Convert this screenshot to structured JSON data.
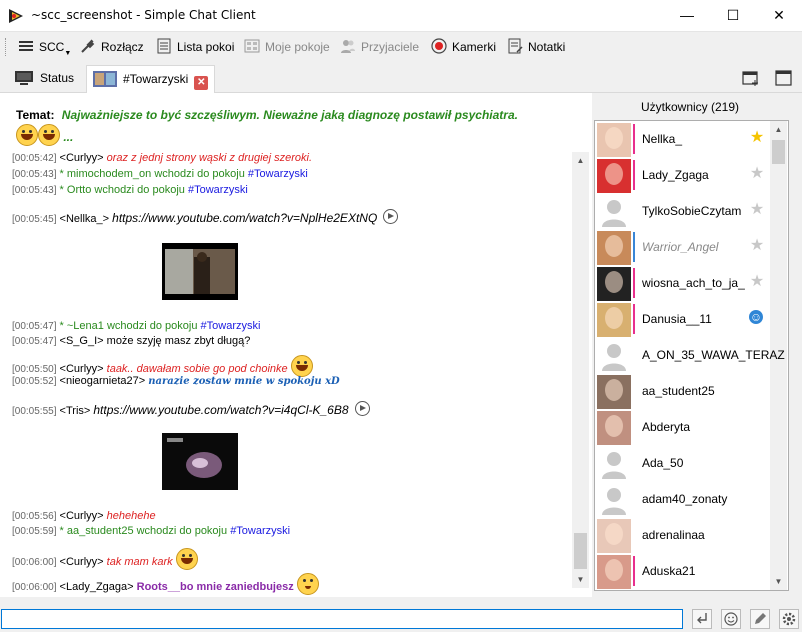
{
  "window": {
    "title": "~scc_screenshot - Simple Chat Client",
    "minimize": "—",
    "maximize": "☐",
    "close": "✕"
  },
  "toolbar": {
    "scc": "SCC",
    "disconnect": "Rozłącz",
    "room_list": "Lista pokoi",
    "my_rooms": "Moje pokoje",
    "friends": "Przyjaciele",
    "cameras": "Kamerki"
  },
  "toolbar_extra": {
    "notes": "Notatki"
  },
  "tabs": [
    {
      "label": "Status"
    },
    {
      "label": "#Towarzyski",
      "close": "✕"
    }
  ],
  "chat": {
    "topic_label": "Temat:",
    "topic_text": "Najważniejsze to być szczęśliwym. Nieważne jaką diagnozę postawił psychiatra.",
    "topic_ellipsis": "...",
    "messages": [
      {
        "ts": "[00:05:42]",
        "nick": "<Curlyy>",
        "text": "oraz z jednj strony wąski z drugiej szeroki."
      },
      {
        "ts": "[00:05:43]",
        "text": "* mimochodem_on wchodzi do pokoju",
        "room": "#Towarzyski"
      },
      {
        "ts": "[00:05:43]",
        "text": "* Ortto wchodzi do pokoju",
        "room": "#Towarzyski"
      },
      {
        "ts": "[00:05:45]",
        "nick": "<Nellka_>",
        "text": "https://www.youtube.com/watch?v=NplHe2EXtNQ"
      },
      {
        "ts": "[00:05:47]",
        "text": "* ~Lena1 wchodzi do pokoju",
        "room": "#Towarzyski"
      },
      {
        "ts": "[00:05:47]",
        "nick": "<S_G_I>",
        "text": "może szyję masz zbyt długą?"
      },
      {
        "ts": "[00:05:50]",
        "nick": "<Curlyy>",
        "text": "taak.. dawałam sobie go pod choinke"
      },
      {
        "ts": "[00:05:52]",
        "nick": "<nieogarnieta27>",
        "text": "narazie zostaw mnie w spokoju xD"
      },
      {
        "ts": "[00:05:55]",
        "nick": "<Tris>",
        "text": "https://www.youtube.com/watch?v=i4qCl-K_6B8"
      },
      {
        "ts": "[00:05:56]",
        "nick": "<Curlyy>",
        "text": "hehehehe"
      },
      {
        "ts": "[00:05:59]",
        "text": "* aa_student25 wchodzi do pokoju",
        "room": "#Towarzyski"
      },
      {
        "ts": "[00:06:00]",
        "nick": "<Curlyy>",
        "text": "tak mam kark"
      },
      {
        "ts": "[00:06:00]",
        "nick": "<Lady_Zgaga>",
        "text": "Roots__bo  mnie zaniedbujesz"
      }
    ]
  },
  "users": {
    "header": "Użytkownicy (219)",
    "list": [
      {
        "nick": "Nellka_",
        "status": "★",
        "status_color": "#f5c400",
        "bar": "#e8308c"
      },
      {
        "nick": "Lady_Zgaga",
        "status": "★",
        "status_color": "#c8c8c8",
        "bar": "#e8308c"
      },
      {
        "nick": "TylkoSobieCzytam",
        "status": "★",
        "status_color": "#c8c8c8",
        "bar": ""
      },
      {
        "nick": "Warrior_Angel",
        "status": "★",
        "status_color": "#c8c8c8",
        "bar": "#3a86d6",
        "italic": true
      },
      {
        "nick": "wiosna_ach_to_ja_",
        "status": "★",
        "status_color": "#c8c8c8",
        "bar": "#e8308c"
      },
      {
        "nick": "Danusia__11",
        "status": "☺",
        "status_color": "#2f86d6",
        "bar": "#e8308c"
      },
      {
        "nick": "A_ON_35_WAWA_TERAZ",
        "status": "",
        "status_color": "",
        "bar": ""
      },
      {
        "nick": "aa_student25",
        "status": "",
        "status_color": "",
        "bar": ""
      },
      {
        "nick": "Abderyta",
        "status": "",
        "status_color": "",
        "bar": ""
      },
      {
        "nick": "Ada_50",
        "status": "",
        "status_color": "",
        "bar": ""
      },
      {
        "nick": "adam40_zonaty",
        "status": "",
        "status_color": "",
        "bar": ""
      },
      {
        "nick": "adrenalinaa",
        "status": "",
        "status_color": "",
        "bar": ""
      },
      {
        "nick": "Aduska21",
        "status": "",
        "status_color": "",
        "bar": "#e8308c"
      }
    ]
  },
  "input": {
    "value": "",
    "placeholder": ""
  }
}
